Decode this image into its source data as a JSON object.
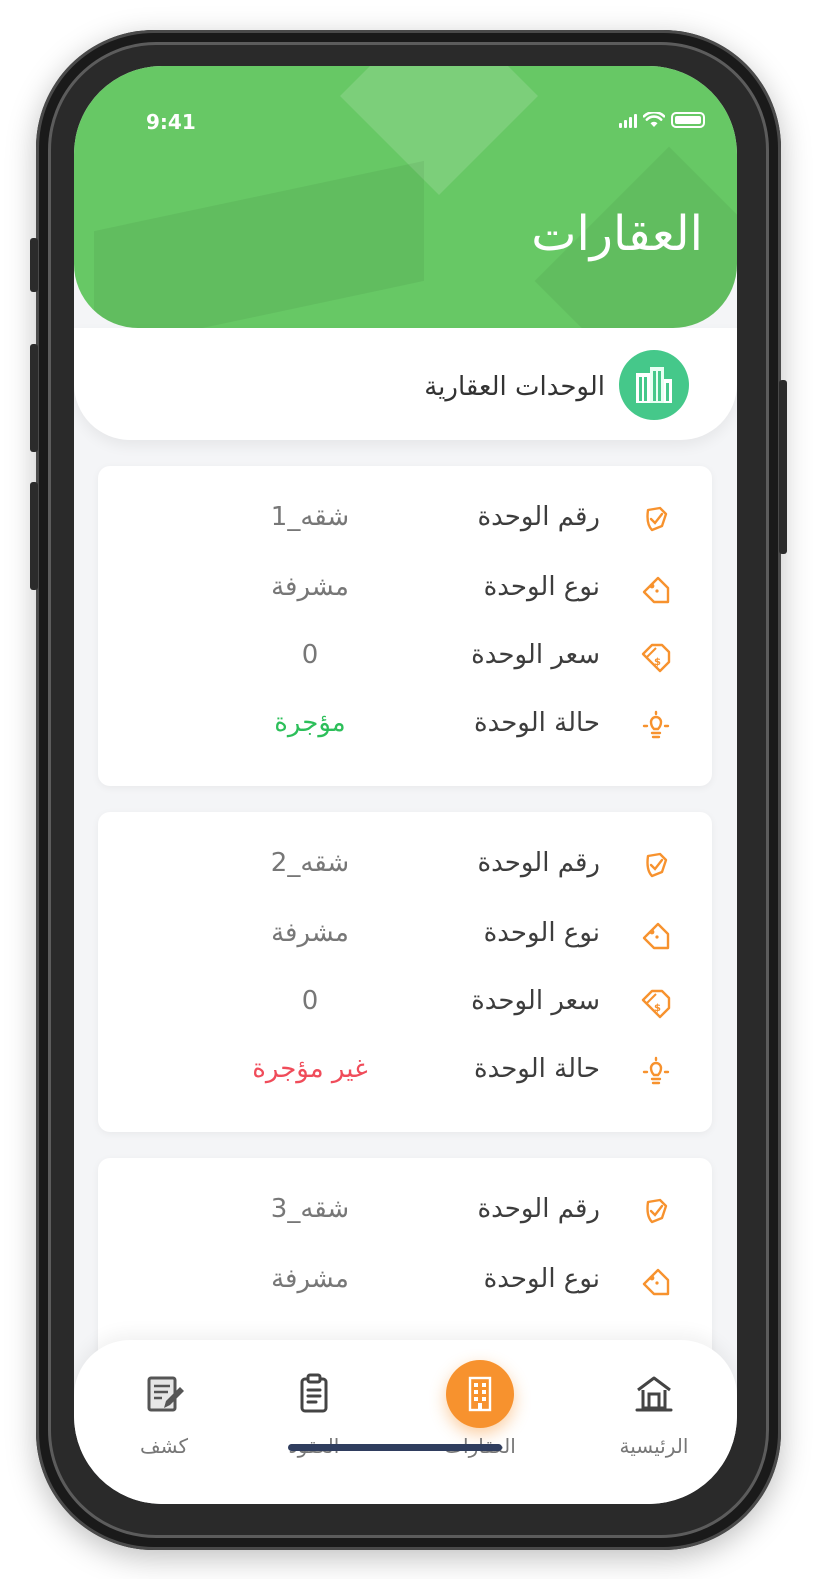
{
  "status_bar": {
    "time": "9:41"
  },
  "header": {
    "title": "العقارات"
  },
  "section": {
    "label": "الوحدات العقارية"
  },
  "units": [
    {
      "rows": [
        {
          "label": "رقم الوحدة",
          "value": "شقه_1"
        },
        {
          "label": "نوع الوحدة",
          "value": "مشرفة"
        },
        {
          "label": "سعر الوحدة",
          "value": "0"
        },
        {
          "label": "حالة الوحدة",
          "value": "مؤجرة",
          "status": "rented"
        }
      ]
    },
    {
      "rows": [
        {
          "label": "رقم الوحدة",
          "value": "شقه_2"
        },
        {
          "label": "نوع الوحدة",
          "value": "مشرفة"
        },
        {
          "label": "سعر الوحدة",
          "value": "0"
        },
        {
          "label": "حالة الوحدة",
          "value": "غير مؤجرة",
          "status": "not-rented"
        }
      ]
    },
    {
      "rows": [
        {
          "label": "رقم الوحدة",
          "value": "شقه_3"
        },
        {
          "label": "نوع الوحدة",
          "value": "مشرفة"
        }
      ]
    }
  ],
  "nav": {
    "home": "الرئيسية",
    "properties": "العقارات",
    "contracts": "العقود",
    "statement": "كشف"
  },
  "colors": {
    "header_green": "#67c865",
    "accent_orange": "#f7922e",
    "status_ok": "#2dbf5a",
    "status_bad": "#f04c5a"
  }
}
